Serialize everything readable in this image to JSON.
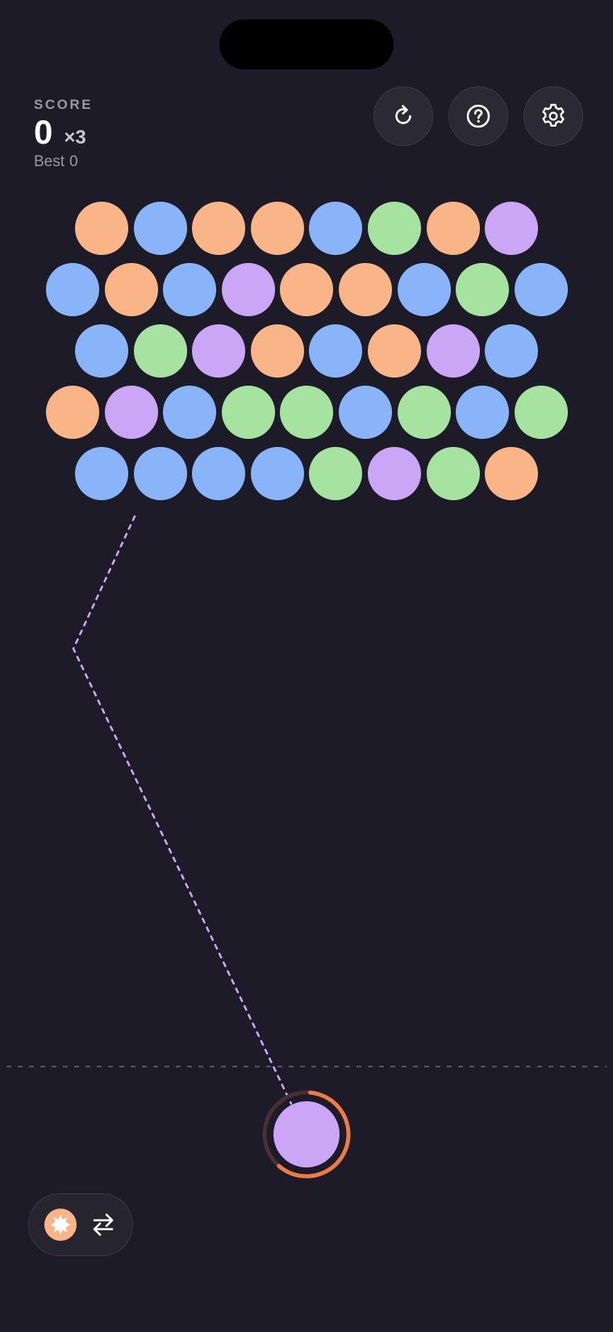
{
  "score": {
    "label": "SCORE",
    "value": "0",
    "multiplier": "×3",
    "best_label": "Best",
    "best_value": "0"
  },
  "top_buttons": [
    {
      "name": "restart-button",
      "icon": "restart-icon"
    },
    {
      "name": "help-button",
      "icon": "help-icon"
    },
    {
      "name": "settings-button",
      "icon": "gear-icon"
    }
  ],
  "colors": {
    "background": "#1c1b27",
    "orange": "#f9b488",
    "blue": "#8ab4fa",
    "green": "#a6e3a1",
    "purple": "#cba6f7",
    "aim_line": "#cba6f7",
    "timer_ring": "#f07a45",
    "timer_track": "#4a2e33"
  },
  "grid": {
    "rows": [
      [
        "orange",
        "blue",
        "orange",
        "orange",
        "blue",
        "green",
        "orange",
        "purple"
      ],
      [
        "blue",
        "orange",
        "blue",
        "purple",
        "orange",
        "orange",
        "blue",
        "green",
        "blue"
      ],
      [
        "blue",
        "green",
        "purple",
        "orange",
        "blue",
        "orange",
        "purple",
        "blue"
      ],
      [
        "orange",
        "purple",
        "blue",
        "green",
        "green",
        "blue",
        "green",
        "blue",
        "green"
      ],
      [
        "blue",
        "blue",
        "blue",
        "blue",
        "green",
        "purple",
        "green",
        "orange"
      ]
    ]
  },
  "shooter": {
    "current_color": "purple",
    "timer_progress": 0.6
  },
  "next": {
    "color": "orange",
    "icon": "starburst-icon",
    "swap_icon": "swap-icon"
  }
}
